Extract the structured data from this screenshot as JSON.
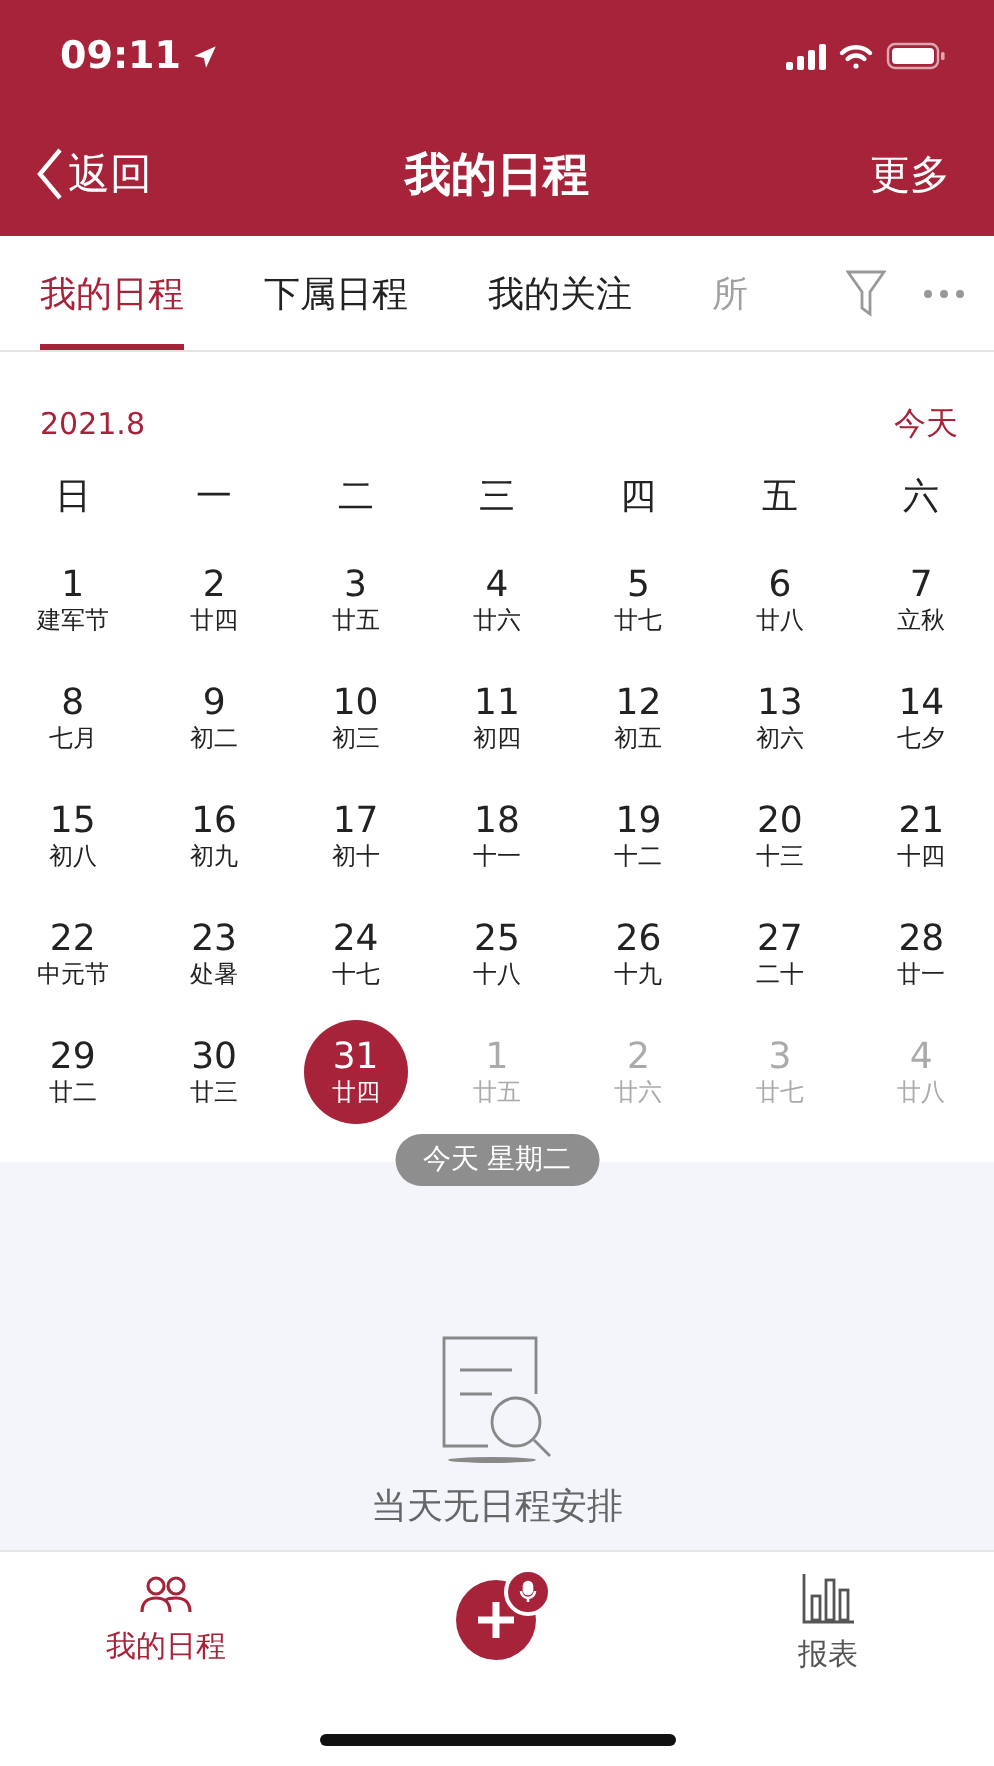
{
  "status_bar": {
    "time": "09:11"
  },
  "nav": {
    "back": "返回",
    "title": "我的日程",
    "more": "更多"
  },
  "tabs": [
    {
      "label": "我的日程",
      "selected": true
    },
    {
      "label": "下属日程",
      "selected": false
    },
    {
      "label": "我的关注",
      "selected": false
    },
    {
      "label": "所",
      "selected": false
    }
  ],
  "calendar": {
    "month": "2021.8",
    "today_button": "今天",
    "weekdays": [
      "日",
      "一",
      "二",
      "三",
      "四",
      "五",
      "六"
    ],
    "weeks": [
      [
        {
          "day": "1",
          "lunar": "建军节",
          "in_month": true,
          "selected": false
        },
        {
          "day": "2",
          "lunar": "廿四",
          "in_month": true,
          "selected": false
        },
        {
          "day": "3",
          "lunar": "廿五",
          "in_month": true,
          "selected": false
        },
        {
          "day": "4",
          "lunar": "廿六",
          "in_month": true,
          "selected": false
        },
        {
          "day": "5",
          "lunar": "廿七",
          "in_month": true,
          "selected": false
        },
        {
          "day": "6",
          "lunar": "廿八",
          "in_month": true,
          "selected": false
        },
        {
          "day": "7",
          "lunar": "立秋",
          "in_month": true,
          "selected": false
        }
      ],
      [
        {
          "day": "8",
          "lunar": "七月",
          "in_month": true,
          "selected": false
        },
        {
          "day": "9",
          "lunar": "初二",
          "in_month": true,
          "selected": false
        },
        {
          "day": "10",
          "lunar": "初三",
          "in_month": true,
          "selected": false
        },
        {
          "day": "11",
          "lunar": "初四",
          "in_month": true,
          "selected": false
        },
        {
          "day": "12",
          "lunar": "初五",
          "in_month": true,
          "selected": false
        },
        {
          "day": "13",
          "lunar": "初六",
          "in_month": true,
          "selected": false
        },
        {
          "day": "14",
          "lunar": "七夕",
          "in_month": true,
          "selected": false
        }
      ],
      [
        {
          "day": "15",
          "lunar": "初八",
          "in_month": true,
          "selected": false
        },
        {
          "day": "16",
          "lunar": "初九",
          "in_month": true,
          "selected": false
        },
        {
          "day": "17",
          "lunar": "初十",
          "in_month": true,
          "selected": false
        },
        {
          "day": "18",
          "lunar": "十一",
          "in_month": true,
          "selected": false
        },
        {
          "day": "19",
          "lunar": "十二",
          "in_month": true,
          "selected": false
        },
        {
          "day": "20",
          "lunar": "十三",
          "in_month": true,
          "selected": false
        },
        {
          "day": "21",
          "lunar": "十四",
          "in_month": true,
          "selected": false
        }
      ],
      [
        {
          "day": "22",
          "lunar": "中元节",
          "in_month": true,
          "selected": false
        },
        {
          "day": "23",
          "lunar": "处暑",
          "in_month": true,
          "selected": false
        },
        {
          "day": "24",
          "lunar": "十七",
          "in_month": true,
          "selected": false
        },
        {
          "day": "25",
          "lunar": "十八",
          "in_month": true,
          "selected": false
        },
        {
          "day": "26",
          "lunar": "十九",
          "in_month": true,
          "selected": false
        },
        {
          "day": "27",
          "lunar": "二十",
          "in_month": true,
          "selected": false
        },
        {
          "day": "28",
          "lunar": "廿一",
          "in_month": true,
          "selected": false
        }
      ],
      [
        {
          "day": "29",
          "lunar": "廿二",
          "in_month": true,
          "selected": false
        },
        {
          "day": "30",
          "lunar": "廿三",
          "in_month": true,
          "selected": false
        },
        {
          "day": "31",
          "lunar": "廿四",
          "in_month": true,
          "selected": true
        },
        {
          "day": "1",
          "lunar": "廿五",
          "in_month": false,
          "selected": false
        },
        {
          "day": "2",
          "lunar": "廿六",
          "in_month": false,
          "selected": false
        },
        {
          "day": "3",
          "lunar": "廿七",
          "in_month": false,
          "selected": false
        },
        {
          "day": "4",
          "lunar": "廿八",
          "in_month": false,
          "selected": false
        }
      ]
    ],
    "date_badge": "今天 星期二"
  },
  "empty_state": {
    "message": "当天无日程安排"
  },
  "bottom_tabs": [
    {
      "kind": "people",
      "label": "我的日程",
      "selected": true
    },
    {
      "kind": "add"
    },
    {
      "kind": "chart",
      "label": "报表",
      "selected": false
    }
  ]
}
